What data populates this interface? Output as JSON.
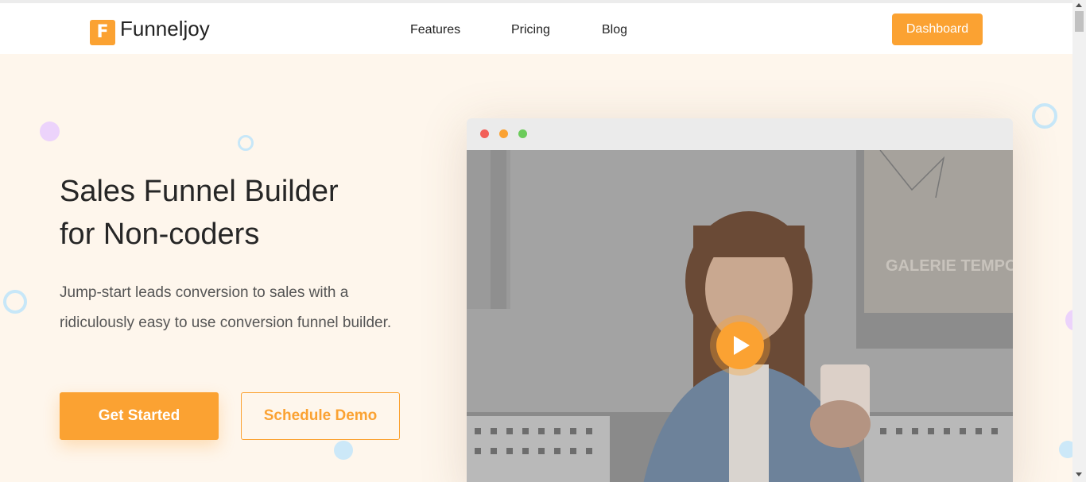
{
  "brand": {
    "initial": "F",
    "name": "Funneljoy",
    "accent": "#fba232"
  },
  "nav": {
    "links": [
      "Features",
      "Pricing",
      "Blog"
    ],
    "dashboard_label": "Dashboard"
  },
  "hero": {
    "title_line1": "Sales Funnel Builder",
    "title_line2": "for Non-coders",
    "subtitle": "Jump-start leads conversion to sales with a ridiculously easy to use conversion funnel builder.",
    "primary_cta": "Get Started",
    "secondary_cta": "Schedule Demo"
  },
  "video": {
    "poster_text": "GALERIE TEMPO",
    "play_icon": "play-icon",
    "window_dots": [
      "#f25f58",
      "#fba232",
      "#6bcb5a"
    ]
  }
}
